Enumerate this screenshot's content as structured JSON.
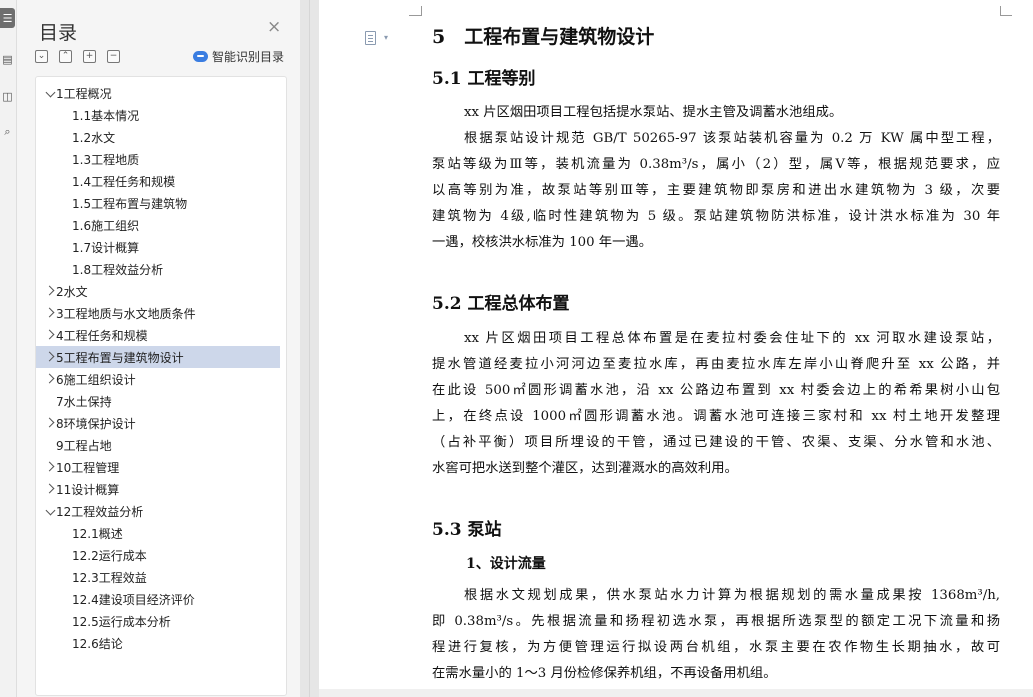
{
  "toc": {
    "title": "目录",
    "close_glyph": "×",
    "smart_label": "智能识别目录",
    "tools": [
      "⌄",
      "⌃",
      "+",
      "−"
    ],
    "items": [
      {
        "label": "1工程概况",
        "level": 0,
        "caret": "down"
      },
      {
        "label": "1.1基本情况",
        "level": 1,
        "caret": "none"
      },
      {
        "label": "1.2水文",
        "level": 1,
        "caret": "none"
      },
      {
        "label": "1.3工程地质",
        "level": 1,
        "caret": "none"
      },
      {
        "label": "1.4工程任务和规模",
        "level": 1,
        "caret": "none"
      },
      {
        "label": "1.5工程布置与建筑物",
        "level": 1,
        "caret": "none"
      },
      {
        "label": "1.6施工组织",
        "level": 1,
        "caret": "none"
      },
      {
        "label": "1.7设计概算",
        "level": 1,
        "caret": "none"
      },
      {
        "label": "1.8工程效益分析",
        "level": 1,
        "caret": "none"
      },
      {
        "label": "2水文",
        "level": 0,
        "caret": "right"
      },
      {
        "label": "3工程地质与水文地质条件",
        "level": 0,
        "caret": "right"
      },
      {
        "label": "4工程任务和规模",
        "level": 0,
        "caret": "right"
      },
      {
        "label": "5工程布置与建筑物设计",
        "level": 0,
        "caret": "right",
        "selected": true
      },
      {
        "label": "6施工组织设计",
        "level": 0,
        "caret": "right"
      },
      {
        "label": "7水土保持",
        "level": 0,
        "caret": "none"
      },
      {
        "label": "8环境保护设计",
        "level": 0,
        "caret": "right"
      },
      {
        "label": "9工程占地",
        "level": 0,
        "caret": "none"
      },
      {
        "label": "10工程管理",
        "level": 0,
        "caret": "right"
      },
      {
        "label": "11设计概算",
        "level": 0,
        "caret": "right"
      },
      {
        "label": "12工程效益分析",
        "level": 0,
        "caret": "down"
      },
      {
        "label": "12.1概述",
        "level": 1,
        "caret": "none"
      },
      {
        "label": "12.2运行成本",
        "level": 1,
        "caret": "none"
      },
      {
        "label": "12.3工程效益",
        "level": 1,
        "caret": "none"
      },
      {
        "label": "12.4建设项目经济评价",
        "level": 1,
        "caret": "none"
      },
      {
        "label": "12.5运行成本分析",
        "level": 1,
        "caret": "none"
      },
      {
        "label": "12.6结论",
        "level": 1,
        "caret": "none"
      }
    ]
  },
  "rail": {
    "icons": [
      "toc-icon",
      "bookmark-icon",
      "comment-icon",
      "search-icon"
    ]
  },
  "doc": {
    "h1": "5　工程布置与建筑物设计",
    "s1_title": "5.1 工程等别",
    "s1_lines": [
      "xx 片区烟田项目工程包括提水泵站、提水主管及调蓄水池组成。",
      "根据泵站设计规范 GB/T 50265-97 该泵站装机容量为 0.2 万 KW 属中型工程，",
      "泵站等级为Ⅲ等，装机流量为 0.38m³/s，属小（2）型，属Ⅴ等，根据规范要求，应",
      "以高等别为准，故泵站等别Ⅲ等，主要建筑物即泵房和进出水建筑物为 3 级，次要",
      "建筑物为 4级,临时性建筑物为 5 级。泵站建筑物防洪标准，设计洪水标准为 30 年",
      "一遇，校核洪水标准为 100 年一遇。"
    ],
    "s2_title": "5.2 工程总体布置",
    "s2_lines": [
      "xx 片区烟田项目工程总体布置是在麦拉村委会住址下的 xx 河取水建设泵站，",
      "提水管道经麦拉小河河边至麦拉水库，再由麦拉水库左岸小山脊爬升至 xx 公路，并",
      "在此设 500㎡圆形调蓄水池，沿 xx 公路边布置到 xx 村委会边上的希希果树小山包",
      "上，在终点设 1000㎡圆形调蓄水池。调蓄水池可连接三家村和 xx 村土地开发整理",
      "（占补平衡）项目所埋设的干管，通过已建设的干管、农渠、支渠、分水管和水池、",
      "水窖可把水送到整个灌区，达到灌溉水的高效利用。"
    ],
    "s3_title": "5.3 泵站",
    "s3_sub": "1、设计流量",
    "s3_lines": [
      "根据水文规划成果，供水泵站水力计算为根据规划的需水量成果按 1368m³/h,",
      "即 0.38m³/s。先根据流量和扬程初选水泵，再根据所选泵型的额定工况下流量和扬",
      "程进行复核，为方便管理运行拟设两台机组，水泵主要在农作物生长期抽水，故可",
      "在需水量小的 1～3 月份检修保养机组，不再设备用机组。"
    ]
  }
}
